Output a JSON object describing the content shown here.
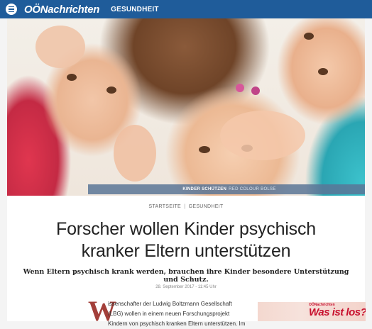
{
  "header": {
    "logo": "OÖNachrichten",
    "section": "GESUNDHEIT",
    "menu_icon": "hamburger-menu-icon"
  },
  "hero": {
    "caption": "KINDER SCHÜTZEN",
    "credit": "RED COLOUR BOLSE"
  },
  "article": {
    "breadcrumb": [
      "STARTSEITE",
      "GESUNDHEIT"
    ],
    "headline_line1": "Forscher wollen Kinder psychisch",
    "headline_line2": "kranker Eltern unterstützen",
    "lead": "Wenn Eltern psychisch krank werden, brauchen ihre Kinder besondere Unterstützung und Schutz.",
    "date": "28. September 2017 - 11:45 Uhr",
    "dropcap": "W",
    "body_lines": [
      "issenschafter der Ludwig Boltzmann Gesellschaft",
      "(LBG) wollen in einem neuen Forschungsprojekt",
      "Kindern von psychisch kranken Eltern unterstützen. Im"
    ]
  },
  "ad": {
    "small": "OÖNachrichten",
    "text": "Was ist los?"
  },
  "colors": {
    "brand_blue": "#1f5c9a",
    "dropcap_red": "#a33f3a",
    "ad_red": "#c8102e"
  }
}
